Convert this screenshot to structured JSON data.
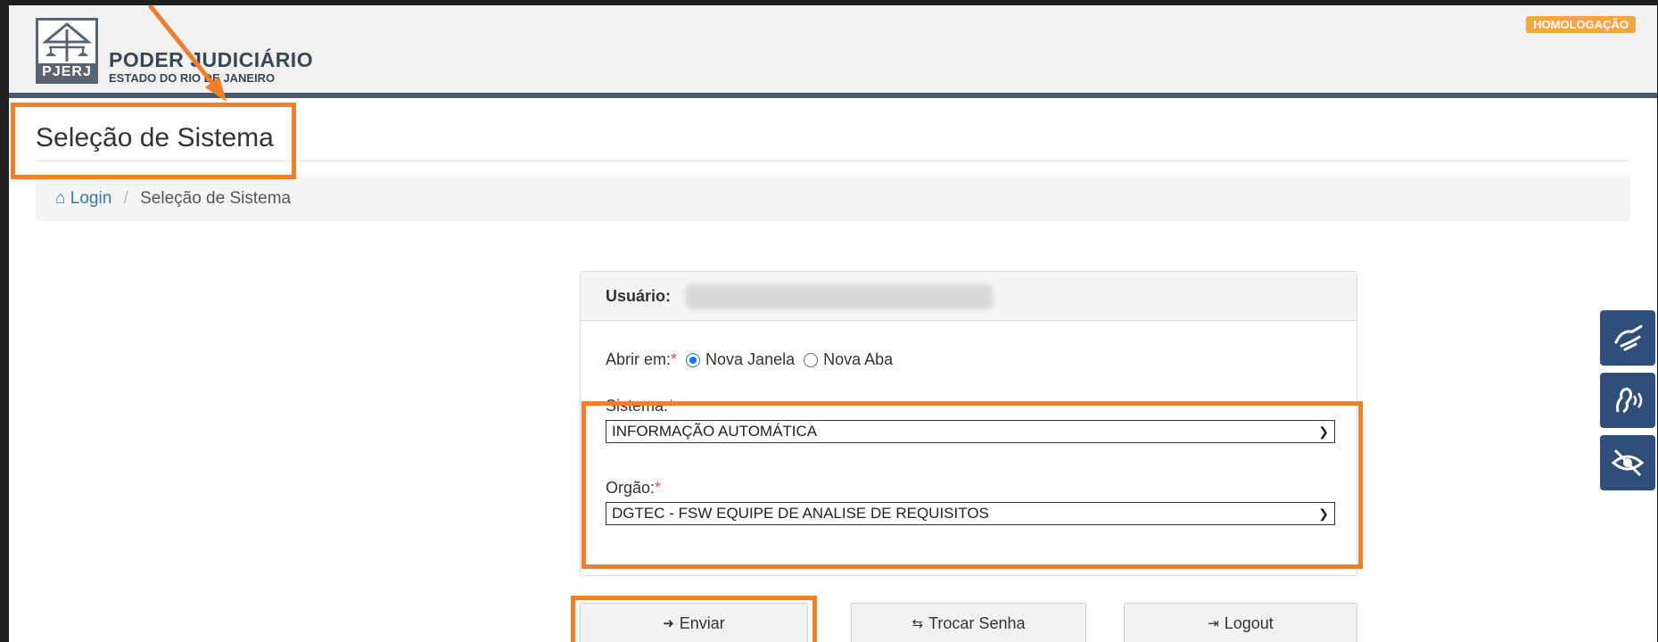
{
  "brand": {
    "logo_text": "PJERJ",
    "title": "PODER JUDICIÁRIO",
    "subtitle": "ESTADO DO RIO DE JANEIRO"
  },
  "env_badge": "HOMOLOGAÇÃO",
  "page_title": "Seleção de Sistema",
  "breadcrumb": {
    "home_label": "Login",
    "current": "Seleção de Sistema"
  },
  "panel": {
    "user_label": "Usuário:",
    "open_label": "Abrir em:",
    "required_mark": "*",
    "open_options": [
      "Nova Janela",
      "Nova Aba"
    ],
    "open_selected": "Nova Janela",
    "sistema_label": "Sistema:",
    "sistema_value": "INFORMAÇÃO AUTOMÁTICA",
    "orgao_label": "Orgão:",
    "orgao_value": "DGTEC - FSW EQUIPE DE ANALISE DE REQUISITOS"
  },
  "buttons": {
    "submit": "Enviar",
    "change_password": "Trocar Senha",
    "logout": "Logout"
  },
  "accessibility": [
    "sign-language-icon",
    "speech-icon",
    "eye-slash-icon"
  ],
  "colors": {
    "accent": "#337ab7",
    "header_bar": "#4a5a6b",
    "badge": "#f0a64a",
    "annotation": "#f07f2d",
    "access": "#2f4f7a"
  }
}
